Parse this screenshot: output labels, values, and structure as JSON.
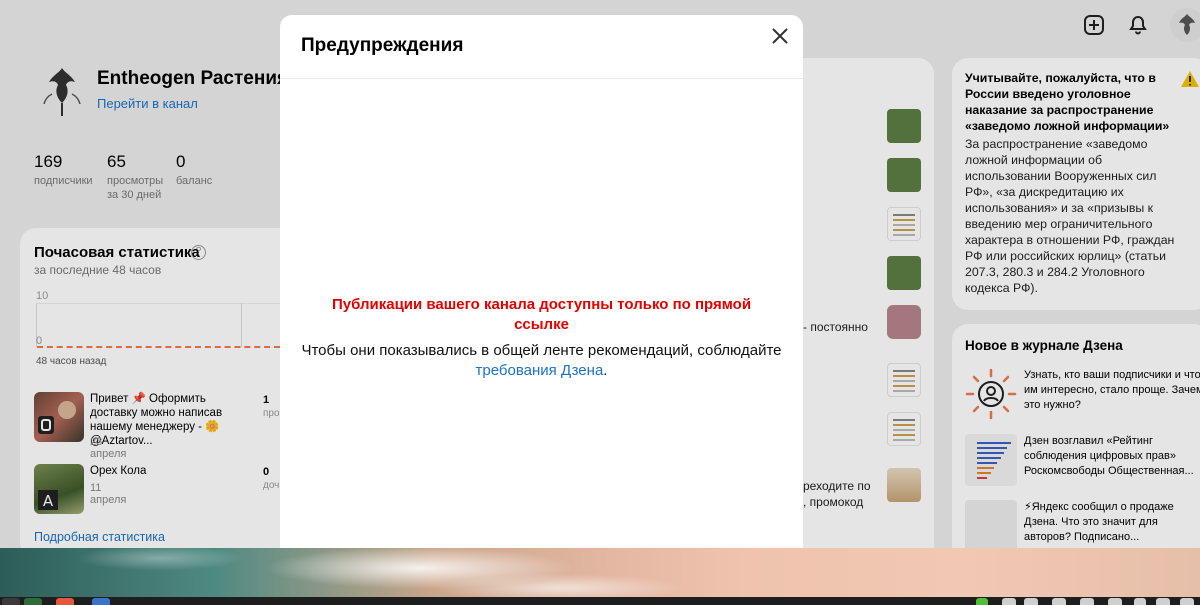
{
  "channel": {
    "name": "Entheogen Растения",
    "link_label": "Перейти в канал",
    "stats": [
      {
        "value": "169",
        "label": "подписчики"
      },
      {
        "value": "65",
        "label": "просмотры за 30 дней"
      },
      {
        "value": "0",
        "label": "баланс"
      }
    ]
  },
  "hourly": {
    "title": "Почасовая статистика",
    "help_icon": "?",
    "subtitle": "за последние 48 часов",
    "axis_top": "10",
    "axis_zero": "0",
    "hours_ago": "48 часов назад"
  },
  "publications": [
    {
      "title": "Привет 📌 Оформить доставку можно написав нашему менеджеру - 🌼 @Aztartov...",
      "date": "23 апреля",
      "count": "1",
      "count_label": "про"
    },
    {
      "title": "Орех Кола",
      "date": "11 апреля",
      "count": "0",
      "count_label": "доч"
    }
  ],
  "detail_link": "Подробная статистика",
  "middle": {
    "text1": "- постоянно",
    "text2": "реходите по",
    "text3": ", промокод"
  },
  "warning": {
    "bold": "Учитывайте, пожалуйста, что в России введено уголовное наказание за распространение «заведомо ложной информации»",
    "body": "За распространение «заведомо ложной информации об использовании Вооруженных сил РФ», «за дискредитацию их использования» и за «призывы к введению мер ограничительного характера в отношении РФ, граждан РФ или российских юрлиц» (статьи 207.3, 280.3 и 284.2 Уголовного кодекса РФ)."
  },
  "journal": {
    "title": "Новое в журнале Дзена",
    "items": [
      {
        "text": "Узнать, кто ваши подписчики и что им интересно, стало проще. Зачем это нужно?"
      },
      {
        "text": "Дзен возглавил «Рейтинг соблюдения цифровых прав» Роскомсвободы Общественная..."
      },
      {
        "text": "⚡Яндекс сообщил о продаже Дзена. Что это значит для авторов? Подписано..."
      }
    ]
  },
  "modal": {
    "title": "Предупреждения",
    "close_icon": "close-icon",
    "red_message": "Публикации вашего канала доступны только по прямой ссылке",
    "message_prefix": "Чтобы они показывались в общей ленте рекомендаций, соблюдайте ",
    "message_link": "требования Дзена",
    "message_suffix": "."
  },
  "colors": {
    "accent_link": "#1a73c8",
    "alert_red": "#e60000",
    "chart_dash": "#f07a4a",
    "warning_yellow": "#f5c400"
  }
}
